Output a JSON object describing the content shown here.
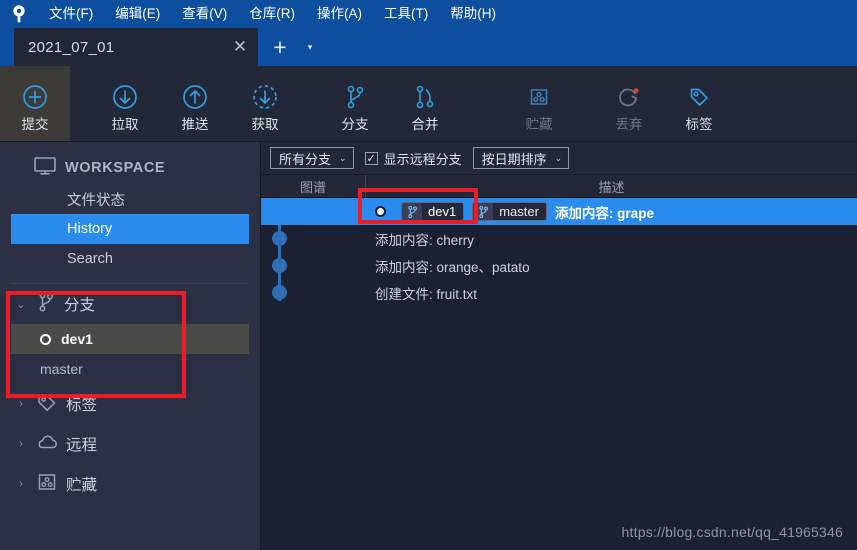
{
  "app": {
    "logo_icon": "sourcetree-logo-icon",
    "menu": [
      {
        "label": "文件(F)",
        "name": "menu-file"
      },
      {
        "label": "编辑(E)",
        "name": "menu-edit"
      },
      {
        "label": "查看(V)",
        "name": "menu-view"
      },
      {
        "label": "仓库(R)",
        "name": "menu-repository"
      },
      {
        "label": "操作(A)",
        "name": "menu-actions"
      },
      {
        "label": "工具(T)",
        "name": "menu-tools"
      },
      {
        "label": "帮助(H)",
        "name": "menu-help"
      }
    ]
  },
  "tabs": {
    "active_tab_label": "2021_07_01",
    "close_glyph": "✕",
    "new_tab_glyph": "+",
    "dropdown_glyph": "▾"
  },
  "toolbar": {
    "buttons": [
      {
        "label": "提交",
        "icon": "commit-icon",
        "active": true,
        "disabled": false
      },
      {
        "label": "拉取",
        "icon": "pull-icon",
        "active": false,
        "disabled": false
      },
      {
        "label": "推送",
        "icon": "push-icon",
        "active": false,
        "disabled": false
      },
      {
        "label": "获取",
        "icon": "fetch-icon",
        "active": false,
        "disabled": false
      },
      {
        "label": "分支",
        "icon": "branch-icon",
        "active": false,
        "disabled": false
      },
      {
        "label": "合并",
        "icon": "merge-icon",
        "active": false,
        "disabled": false
      },
      {
        "label": "贮藏",
        "icon": "stash-icon",
        "active": false,
        "disabled": true
      },
      {
        "label": "丢弃",
        "icon": "discard-icon",
        "active": false,
        "disabled": true
      },
      {
        "label": "标签",
        "icon": "tag-icon",
        "active": false,
        "disabled": false
      }
    ]
  },
  "sidebar": {
    "workspace": {
      "label": "WORKSPACE",
      "icon": "monitor-icon"
    },
    "workspace_items": [
      {
        "label": "文件状态",
        "selected": false,
        "name": "sidebar-item-file-status"
      },
      {
        "label": "History",
        "selected": true,
        "name": "sidebar-item-history"
      },
      {
        "label": "Search",
        "selected": false,
        "name": "sidebar-item-search"
      }
    ],
    "groups": [
      {
        "label": "分支",
        "icon": "branch-icon",
        "expanded": true,
        "chevron": "⌄",
        "items": [
          {
            "label": "dev1",
            "current": true
          },
          {
            "label": "master",
            "current": false
          }
        ]
      },
      {
        "label": "标签",
        "icon": "tag-icon",
        "expanded": false,
        "chevron": "›",
        "items": []
      },
      {
        "label": "远程",
        "icon": "cloud-icon",
        "expanded": false,
        "chevron": "›",
        "items": []
      },
      {
        "label": "贮藏",
        "icon": "stash-icon",
        "expanded": false,
        "chevron": "›",
        "items": []
      }
    ]
  },
  "main": {
    "filters": {
      "branch_select": "所有分支",
      "show_remote_label": "显示远程分支",
      "show_remote_checked": true,
      "check_glyph": "✓",
      "sort_select": "按日期排序",
      "caret_glyph": "⌄"
    },
    "columns": {
      "graph": "图谱",
      "description": "描述"
    },
    "commits": [
      {
        "message": "添加内容: grape",
        "selected": true,
        "refs": [
          {
            "name": "dev1",
            "current": true,
            "icon": "branch-icon"
          },
          {
            "name": "master",
            "current": false,
            "icon": "branch-icon"
          }
        ]
      },
      {
        "message": "添加内容: cherry",
        "selected": false,
        "refs": []
      },
      {
        "message": "添加内容: orange、patato",
        "selected": false,
        "refs": []
      },
      {
        "message": "创建文件: fruit.txt",
        "selected": false,
        "refs": []
      }
    ]
  },
  "watermark": "https://blog.csdn.net/qq_41965346",
  "colors": {
    "menubar_blue": "#0d4f9e",
    "selection_blue": "#2b8cf0",
    "panel_dark": "#1b2033",
    "sidebar_bg": "#2b3044",
    "toolbar_bg": "#232839",
    "accent_cyan": "#2f9fe0",
    "annotation_red": "#ee1c25",
    "graph_blue": "#2f6fb5"
  }
}
